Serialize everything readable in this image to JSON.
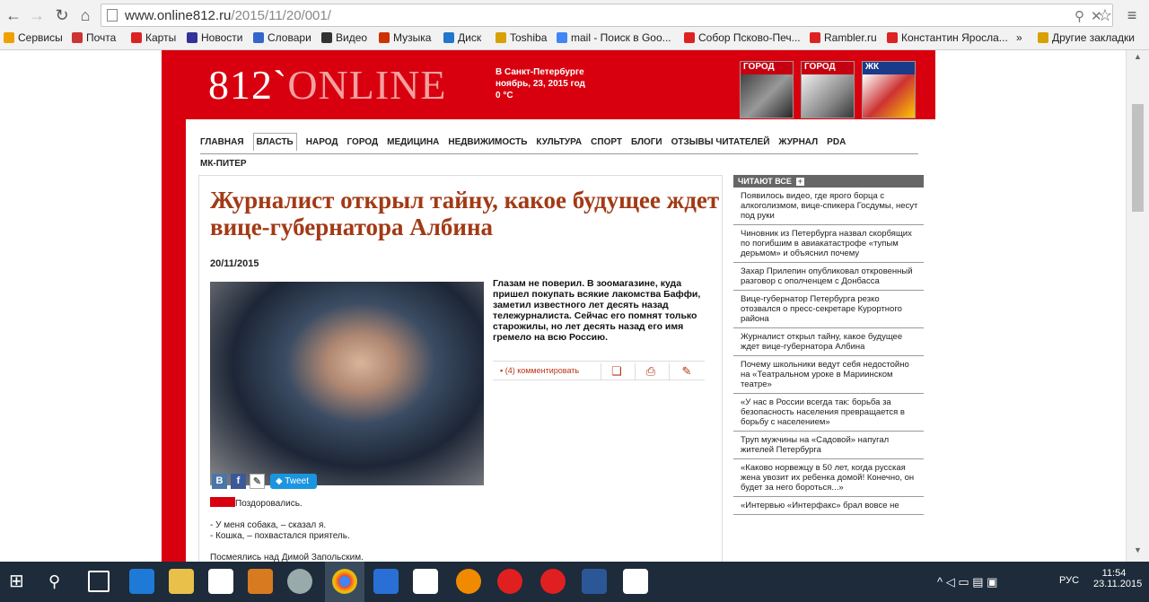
{
  "browser": {
    "url_domain": "www.online812.ru",
    "url_path": "/2015/11/20/001/",
    "bookmarks": [
      {
        "label": "Сервисы",
        "color": "#f0a000"
      },
      {
        "label": "Почта",
        "color": "#cc3333"
      },
      {
        "label": "Карты",
        "color": "#dd2222"
      },
      {
        "label": "Новости",
        "color": "#333399"
      },
      {
        "label": "Словари",
        "color": "#3366cc"
      },
      {
        "label": "Видео",
        "color": "#333333"
      },
      {
        "label": "Музыка",
        "color": "#cc3300"
      },
      {
        "label": "Диск",
        "color": "#2277cc"
      },
      {
        "label": "Toshiba",
        "color": "#d8a000"
      },
      {
        "label": "mail - Поиск в Goo...",
        "color": "#4285f4"
      },
      {
        "label": "Собор Псково-Печ...",
        "color": "#dd2222"
      },
      {
        "label": "Rambler.ru",
        "color": "#dd2222"
      },
      {
        "label": "Константин Яросла...",
        "color": "#dd2222"
      }
    ],
    "overflow": "»",
    "other_bookmarks": "Другие закладки"
  },
  "site": {
    "logo_main": "812",
    "logo_sep": "`",
    "logo_online": "ONLINE",
    "city": "В Санкт-Петербурге",
    "date_line": "ноябрь, 23, 2015 год",
    "temp": "0 °C",
    "magazines": [
      "ГОРОД",
      "ГОРОД",
      "ЖК"
    ]
  },
  "menu": {
    "items": [
      "ГЛАВНАЯ",
      "ВЛАСТЬ",
      "НАРОД",
      "ГОРОД",
      "МЕДИЦИНА",
      "НЕДВИЖИМОСТЬ",
      "КУЛЬТУРА",
      "СПОРТ",
      "БЛОГИ",
      "ОТЗЫВЫ ЧИТАТЕЛЕЙ",
      "ЖУРНАЛ",
      "PDA"
    ],
    "second": "МК-ПИТЕР"
  },
  "article": {
    "headline": "Журналист открыл тайну, какое будущее ждет вице-губернатора Албина",
    "date": "20/11/2015",
    "lead": "Глазам не поверил. В зоомагазине, куда пришел покупать всякие лакомства Баффи, заметил известного лет десять назад тележурналиста. Сейчас его помнят только старожилы, но лет десять назад его имя гремело на всю Россию.",
    "comments": "(4) комментировать",
    "tweet": "Tweet",
    "p1": "Поздоровались.",
    "p2": "- У меня собака, – сказал я.",
    "p3": "- Кошка, – похвастался приятель.",
    "p4": "Посмеялись над Димой Запольским."
  },
  "sidebar": {
    "title": "ЧИТАЮТ ВСЕ",
    "items": [
      "Появилось видео, где ярого борца с алкоголизмом, вице-спикера Госдумы, несут под руки",
      "Чиновник из Петербурга назвал скорбящих по погибшим в авиакатастрофе «тупым дерьмом» и объяснил почему",
      "Захар Прилепин опубликовал откровенный разговор с ополченцем с Донбасса",
      "Вице-губернатор Петербурга резко отозвался о пресс-секретаре Курортного района",
      "Журналист открыл тайну, какое будущее ждет вице-губернатора Албина",
      "Почему школьники ведут себя недостойно на «Театральном уроке в Мариинском театре»",
      "«У нас в России всегда так: борьба за безопасность населения превращается в борьбу с населением»",
      "Труп мужчины на «Садовой» напугал жителей Петербурга",
      "«Каково норвежцу в 50 лет, когда русская жена увозит их ребенка домой! Конечно, он будет за него бороться...»",
      "«Интервью «Интерфакс» брал вовсе не"
    ]
  },
  "taskbar": {
    "lang": "РУС",
    "time": "11:54",
    "date": "23.11.2015"
  }
}
